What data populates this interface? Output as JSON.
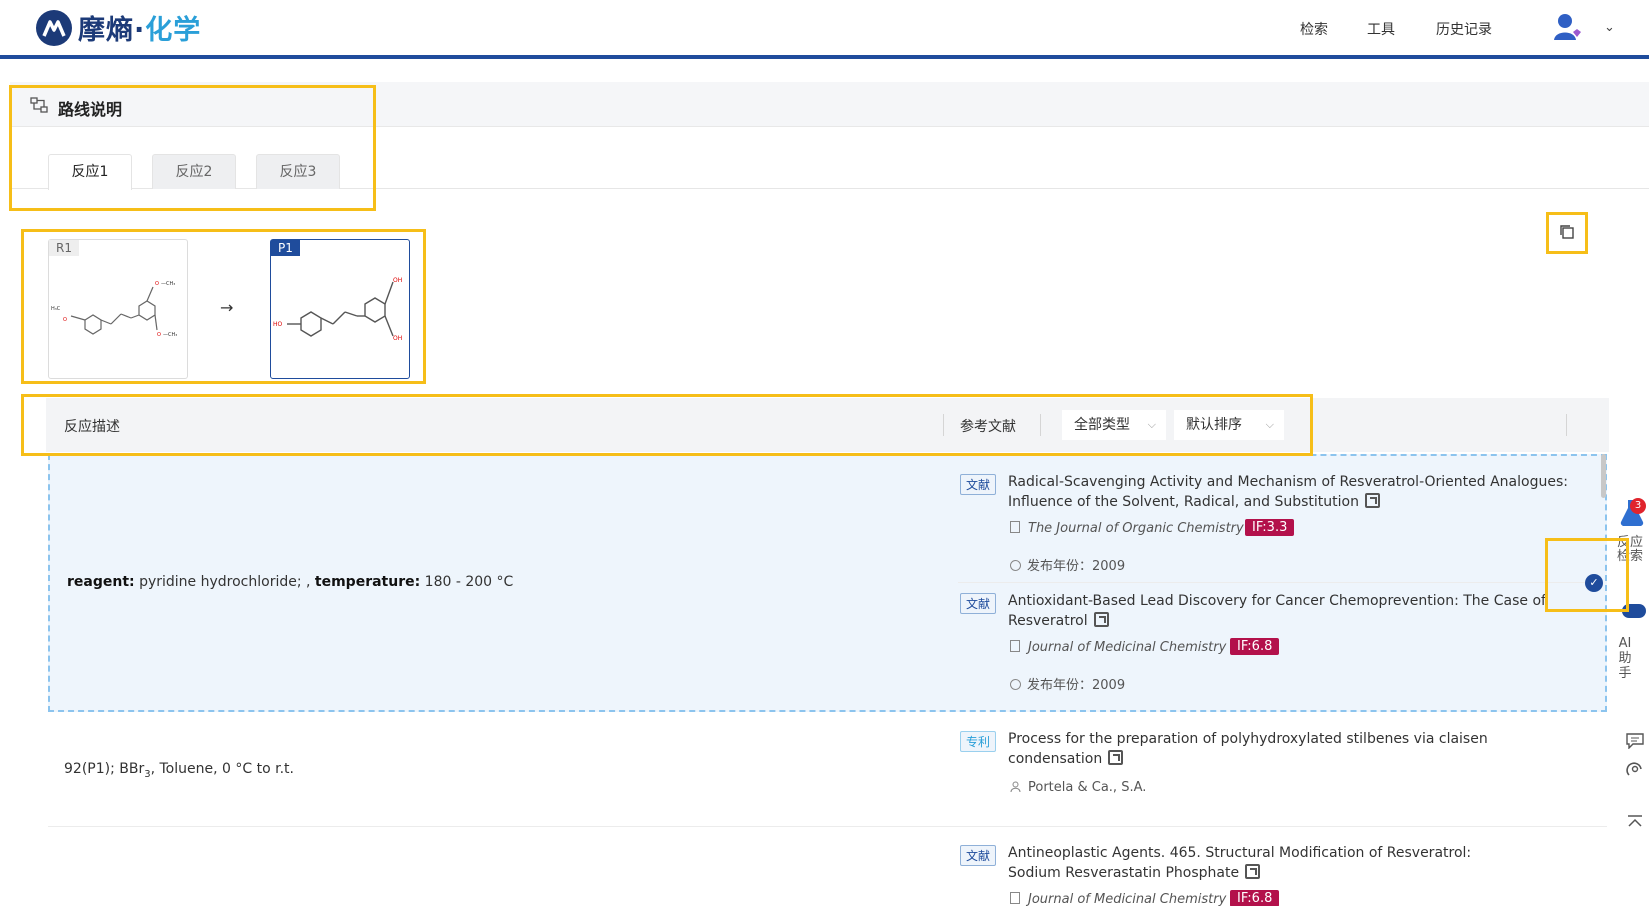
{
  "brand": {
    "name_part1": "摩熵",
    "name_part2": "化学"
  },
  "nav": {
    "search": "检索",
    "tools": "工具",
    "history": "历史记录"
  },
  "route": {
    "title": "路线说明",
    "tabs": [
      "反应1",
      "反应2",
      "反应3"
    ],
    "active_tab": 0
  },
  "reaction": {
    "reactant_tag": "R1",
    "product_tag": "P1",
    "arrow": "→"
  },
  "table": {
    "col_desc": "反应描述",
    "col_ref": "参考文献",
    "type_select": "全部类型",
    "sort_select": "默认排序"
  },
  "rows": [
    {
      "desc_reagent_label": "reagent:",
      "desc_reagent": " pyridine hydrochloride; , ",
      "desc_temp_label": "temperature:",
      "desc_temp": " 180 - 200 °C",
      "refs": [
        {
          "type": "文献",
          "title": "Radical-Scavenging Activity and Mechanism of Resveratrol-Oriented Analogues: Influence of the Solvent, Radical, and Substitution",
          "journal": "The Journal of Organic Chemistry",
          "if": "IF:3.3",
          "year_label": "发布年份：",
          "year": "2009"
        },
        {
          "type": "文献",
          "title": "Antioxidant-Based Lead Discovery for Cancer Chemoprevention: The Case of Resveratrol",
          "journal": "Journal of Medicinal Chemistry",
          "if": "IF:6.8",
          "year_label": "发布年份：",
          "year": "2009"
        }
      ]
    },
    {
      "desc_prefix": "92(P1); BBr",
      "desc_sub": "3",
      "desc_suffix": ", Toluene, 0 °C to r.t.",
      "refs": [
        {
          "type": "专利",
          "title": "Process for the preparation of polyhydroxylated stilbenes via claisen condensation",
          "assignee": "Portela & Ca., S.A."
        }
      ]
    },
    {
      "refs": [
        {
          "type": "文献",
          "title": "Antineoplastic Agents. 465. Structural Modification of Resveratrol: Sodium Resverastatin Phosphate",
          "journal": "Journal of Medicinal Chemistry",
          "if": "IF:6.8"
        }
      ]
    }
  ],
  "float_panel": {
    "reaction_search": "反应检索",
    "badge_count": "3",
    "ai_assistant": "AI助手"
  },
  "colors": {
    "brand": "#1c3a78",
    "accent": "#2a9fd8",
    "highlight": "#f6be18",
    "if_badge": "#b3114b"
  }
}
